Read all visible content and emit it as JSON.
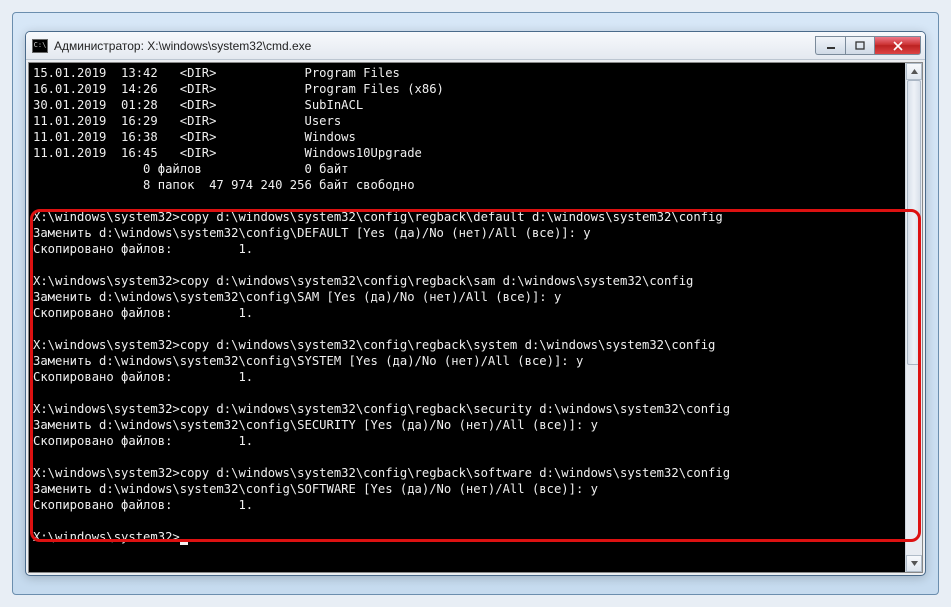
{
  "titlebar": {
    "icon_label": "C:\\",
    "title": "Администратор: X:\\windows\\system32\\cmd.exe"
  },
  "dir_listing": [
    {
      "date": "15.01.2019",
      "time": "13:42",
      "type": "<DIR>",
      "name": "Program Files"
    },
    {
      "date": "16.01.2019",
      "time": "14:26",
      "type": "<DIR>",
      "name": "Program Files (x86)"
    },
    {
      "date": "30.01.2019",
      "time": "01:28",
      "type": "<DIR>",
      "name": "SubInACL"
    },
    {
      "date": "11.01.2019",
      "time": "16:29",
      "type": "<DIR>",
      "name": "Users"
    },
    {
      "date": "11.01.2019",
      "time": "16:38",
      "type": "<DIR>",
      "name": "Windows"
    },
    {
      "date": "11.01.2019",
      "time": "16:45",
      "type": "<DIR>",
      "name": "Windows10Upgrade"
    }
  ],
  "summary": {
    "files_line": "               0 файлов              0 байт",
    "dirs_line": "               8 папок  47 974 240 256 байт свободно"
  },
  "copy_ops": [
    {
      "cmd": "X:\\windows\\system32>copy d:\\windows\\system32\\config\\regback\\default d:\\windows\\system32\\config",
      "replace": "Заменить d:\\windows\\system32\\config\\DEFAULT [Yes (да)/No (нет)/All (все)]: y",
      "copied": "Скопировано файлов:         1."
    },
    {
      "cmd": "X:\\windows\\system32>copy d:\\windows\\system32\\config\\regback\\sam d:\\windows\\system32\\config",
      "replace": "Заменить d:\\windows\\system32\\config\\SAM [Yes (да)/No (нет)/All (все)]: y",
      "copied": "Скопировано файлов:         1."
    },
    {
      "cmd": "X:\\windows\\system32>copy d:\\windows\\system32\\config\\regback\\system d:\\windows\\system32\\config",
      "replace": "Заменить d:\\windows\\system32\\config\\SYSTEM [Yes (да)/No (нет)/All (все)]: y",
      "copied": "Скопировано файлов:         1."
    },
    {
      "cmd": "X:\\windows\\system32>copy d:\\windows\\system32\\config\\regback\\security d:\\windows\\system32\\config",
      "replace": "Заменить d:\\windows\\system32\\config\\SECURITY [Yes (да)/No (нет)/All (все)]: y",
      "copied": "Скопировано файлов:         1."
    },
    {
      "cmd": "X:\\windows\\system32>copy d:\\windows\\system32\\config\\regback\\software d:\\windows\\system32\\config",
      "replace": "Заменить d:\\windows\\system32\\config\\SOFTWARE [Yes (да)/No (нет)/All (все)]: y",
      "copied": "Скопировано файлов:         1."
    }
  ],
  "prompt": "X:\\windows\\system32>"
}
